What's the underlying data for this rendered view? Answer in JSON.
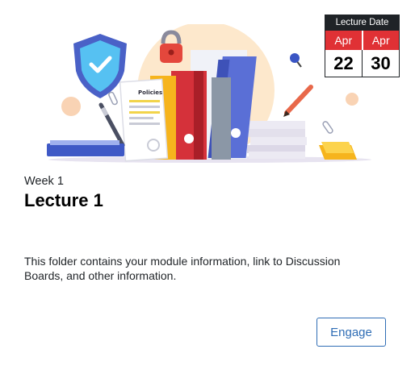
{
  "badge": {
    "header": "Lecture Date",
    "start_month": "Apr",
    "start_day": "22",
    "end_month": "Apr",
    "end_day": "30"
  },
  "card": {
    "week": "Week 1",
    "title": "Lecture 1",
    "description": "This folder contains your module information, link to Discussion Boards, and other information.",
    "engage_label": "Engage"
  },
  "illustration": {
    "document_label": "Policies"
  },
  "colors": {
    "accent": "#2f6db5",
    "badge_red": "#e03135",
    "badge_dark": "#1f2327"
  }
}
